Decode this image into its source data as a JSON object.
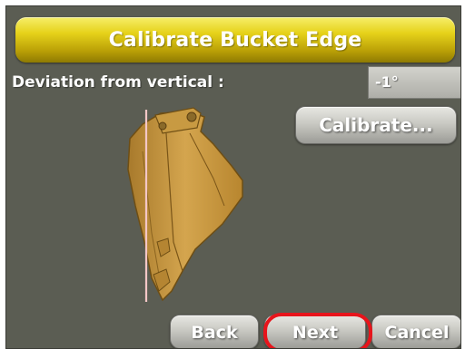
{
  "title": "Calibrate Bucket Edge",
  "deviation": {
    "label": "Deviation from vertical :",
    "value": "-1°"
  },
  "buttons": {
    "calibrate": "Calibrate...",
    "back": "Back",
    "next": "Next",
    "cancel": "Cancel"
  },
  "colors": {
    "title_bar": "#e6d21a",
    "background": "#5b5d53",
    "bucket": "#c99a3e",
    "vertical_line": "#f4c7c7",
    "highlight": "#e8141b"
  }
}
